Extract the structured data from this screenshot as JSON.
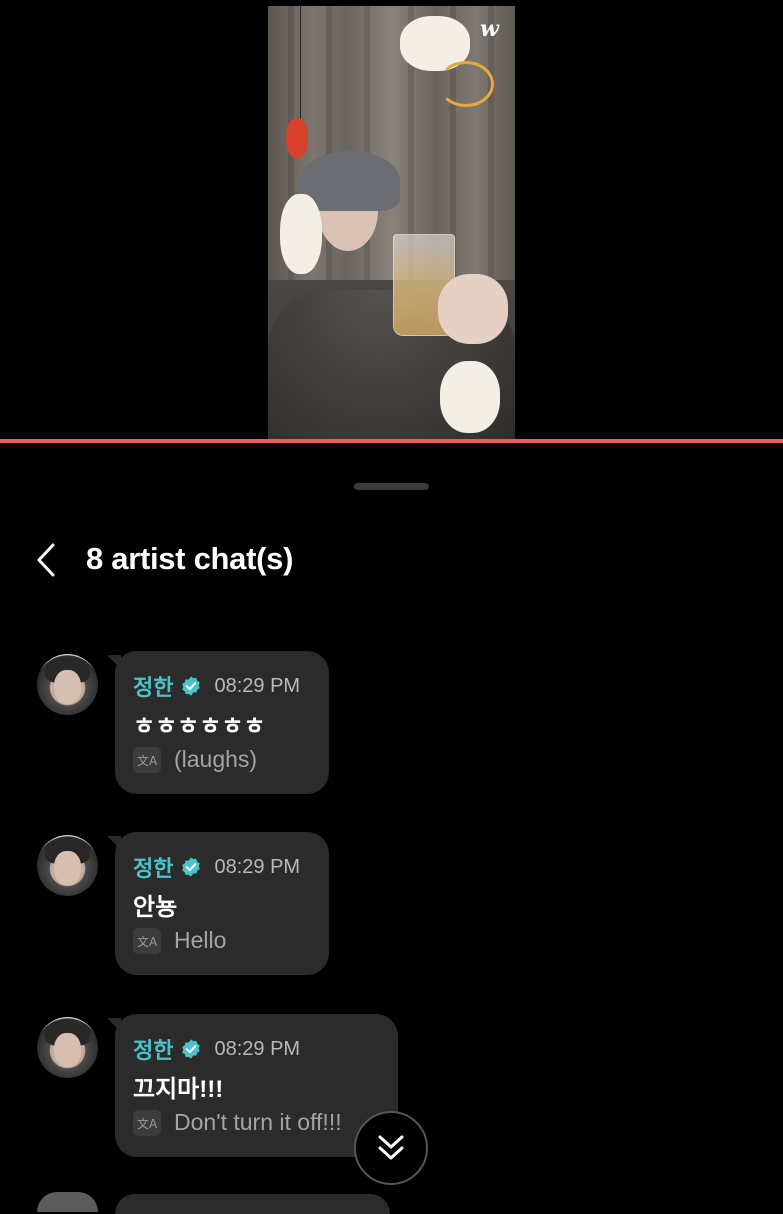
{
  "header": {
    "title": "8 artist chat(s)"
  },
  "video": {
    "logo": "w"
  },
  "messages": [
    {
      "sender": "정한",
      "time": "08:29 PM",
      "text": "ㅎㅎㅎㅎㅎㅎ",
      "translation": "(laughs)"
    },
    {
      "sender": "정한",
      "time": "08:29 PM",
      "text": "안뇽",
      "translation": "Hello"
    },
    {
      "sender": "정한",
      "time": "08:29 PM",
      "text": "끄지마!!!",
      "translation": "Don't turn it off!!!"
    }
  ],
  "icons": {
    "back": "chevron-left-icon",
    "verified": "verified-badge-icon",
    "translate": "translate-icon",
    "scroll_down": "double-chevron-down-icon"
  },
  "colors": {
    "background": "#000000",
    "accent_line": "#e85d5d",
    "sender_name": "#49c3c8",
    "bubble": "#2b2b2b",
    "timestamp": "#b9b9b9",
    "translation": "#a4a4a4"
  }
}
